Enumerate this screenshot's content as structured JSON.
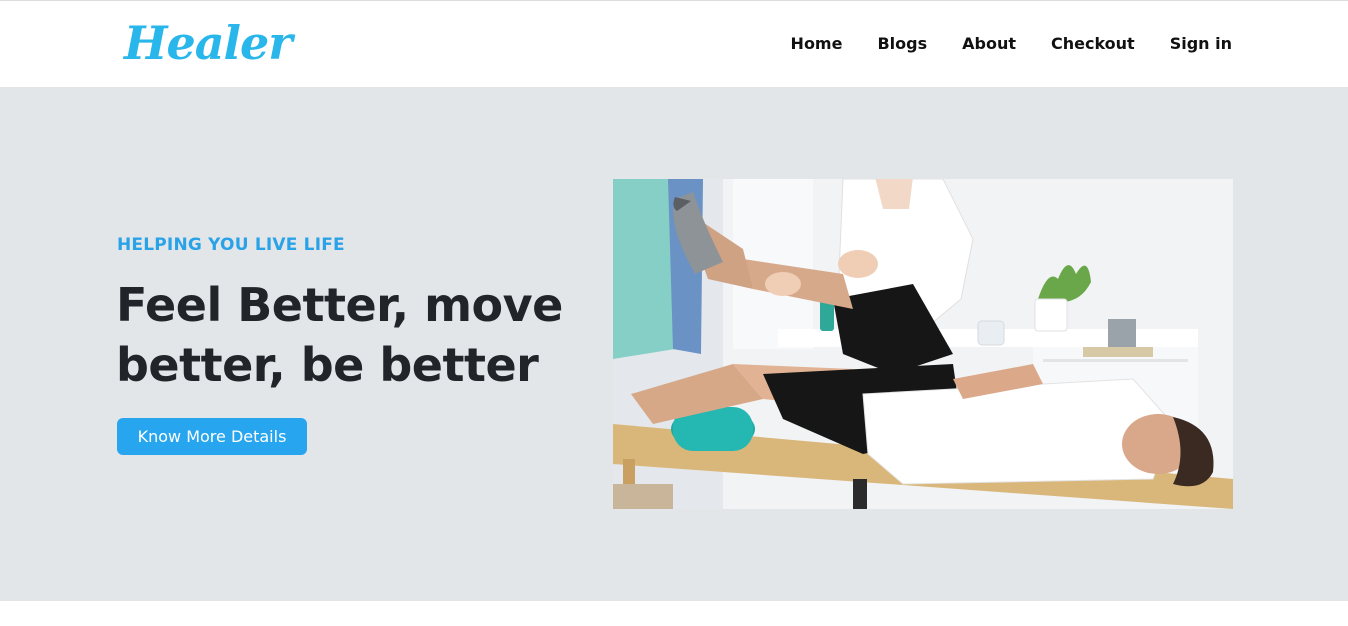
{
  "brand": {
    "logo_text": "Healer"
  },
  "nav": {
    "items": [
      {
        "label": "Home"
      },
      {
        "label": "Blogs"
      },
      {
        "label": "About"
      },
      {
        "label": "Checkout"
      },
      {
        "label": "Sign in"
      }
    ]
  },
  "hero": {
    "eyebrow": "HELPING YOU LIVE LIFE",
    "headline": "Feel Better, move better, be better",
    "cta_label": "Know More Details",
    "image": {
      "subject": "physiotherapist-stretching-patient-leg"
    }
  },
  "colors": {
    "accent": "#29b6ea",
    "button": "#27a5ee",
    "hero_bg": "#e3e6e9",
    "headline": "#21252a"
  }
}
